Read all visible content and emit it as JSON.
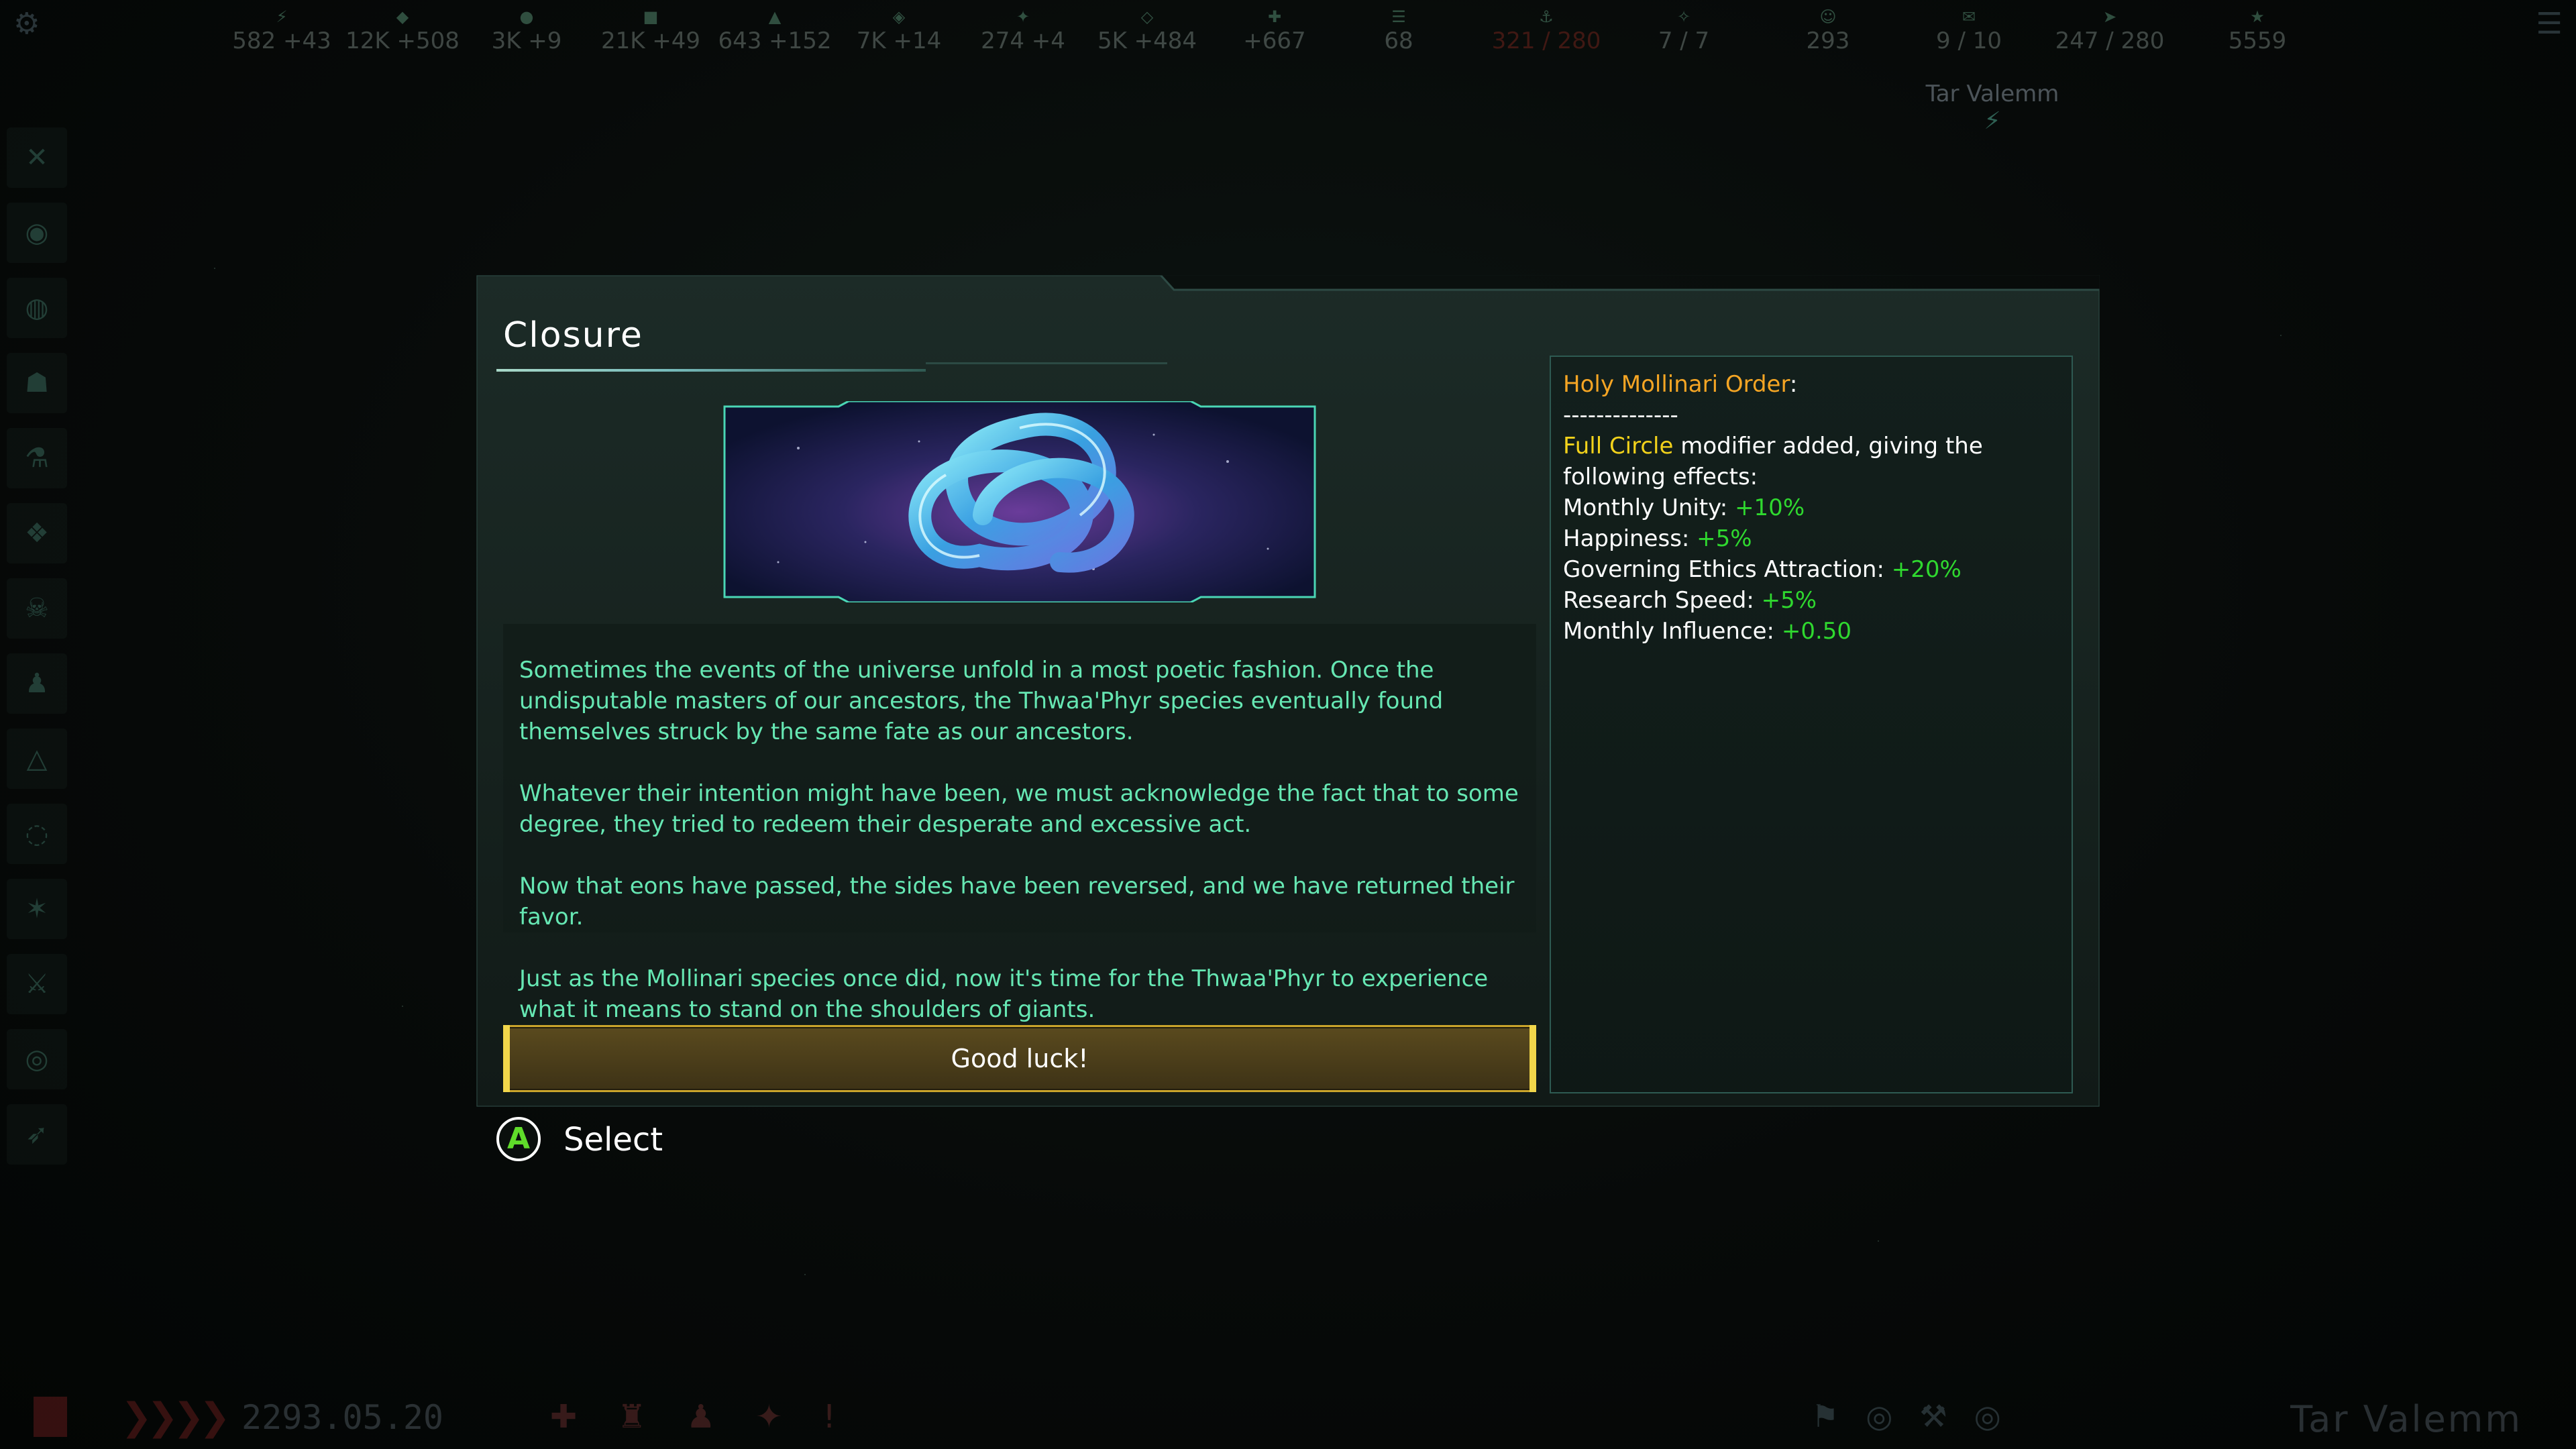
{
  "top_bar": {
    "resources": [
      {
        "icon": "energy-icon",
        "value": "582 +43"
      },
      {
        "icon": "minerals-icon",
        "value": "12K +508"
      },
      {
        "icon": "food-icon",
        "value": "3K +9"
      },
      {
        "icon": "consumer-goods-icon",
        "value": "21K +49"
      },
      {
        "icon": "alloys-icon",
        "value": "643 +152"
      },
      {
        "icon": "influence-icon",
        "value": "7K +14"
      },
      {
        "icon": "unity-icon",
        "value": "274 +4"
      },
      {
        "icon": "research-icon",
        "value": "5K +484"
      },
      {
        "icon": "amenities-icon",
        "value": "+667"
      },
      {
        "icon": "stability-icon",
        "value": "68"
      },
      {
        "icon": "naval-capacity-icon",
        "value": "321 / 280",
        "alert": true
      },
      {
        "icon": "starbase-icon",
        "value": "7 / 7"
      },
      {
        "icon": "pops-icon",
        "value": "293"
      },
      {
        "icon": "envoys-icon",
        "value": "9 / 10"
      },
      {
        "icon": "fleet-icon",
        "value": "247 / 280"
      },
      {
        "icon": "score-icon",
        "value": "5559"
      }
    ]
  },
  "empire_name_top": "Tar Valemm",
  "event": {
    "title": "Closure",
    "paragraphs": [
      "Sometimes the events of the universe unfold in a most poetic fashion. Once the undisputable masters of our ancestors, the Thwaa'Phyr species eventually found themselves struck by the same fate as our ancestors.",
      "Whatever their intention might have been, we must acknowledge the fact that to some degree, they tried to redeem their desperate and excessive act.",
      "Now that eons have passed, the sides have been reversed, and we have returned their favor.",
      "Just as the Mollinari species once did, now it's time for the Thwaa'Phyr to experience what it means to stand on the shoulders of giants."
    ],
    "option_label": "Good luck!",
    "effects": {
      "org_name": "Holy Mollinari Order",
      "org_colon": ":",
      "separator": "--------------",
      "modifier_name": "Full Circle",
      "modifier_text_1": " modifier added, giving the",
      "modifier_text_2": "following effects:",
      "lines": [
        {
          "label": "Monthly Unity: ",
          "value": "+10%"
        },
        {
          "label": "Happiness: ",
          "value": "+5%"
        },
        {
          "label": "Governing Ethics Attraction: ",
          "value": "+20%"
        },
        {
          "label": "Research Speed: ",
          "value": "+5%"
        },
        {
          "label": "Monthly Influence: ",
          "value": "+0.50"
        }
      ]
    }
  },
  "hint": {
    "button": "A",
    "label": "Select"
  },
  "bottom_bar": {
    "date": "2293.05.20",
    "empire_name": "Tar Valemm"
  },
  "colors": {
    "text_green": "#66e7b3",
    "org": "#f5a524",
    "modifier": "#f2d21b",
    "positive": "#2fd82f",
    "button_gold": "#c9a42b"
  }
}
